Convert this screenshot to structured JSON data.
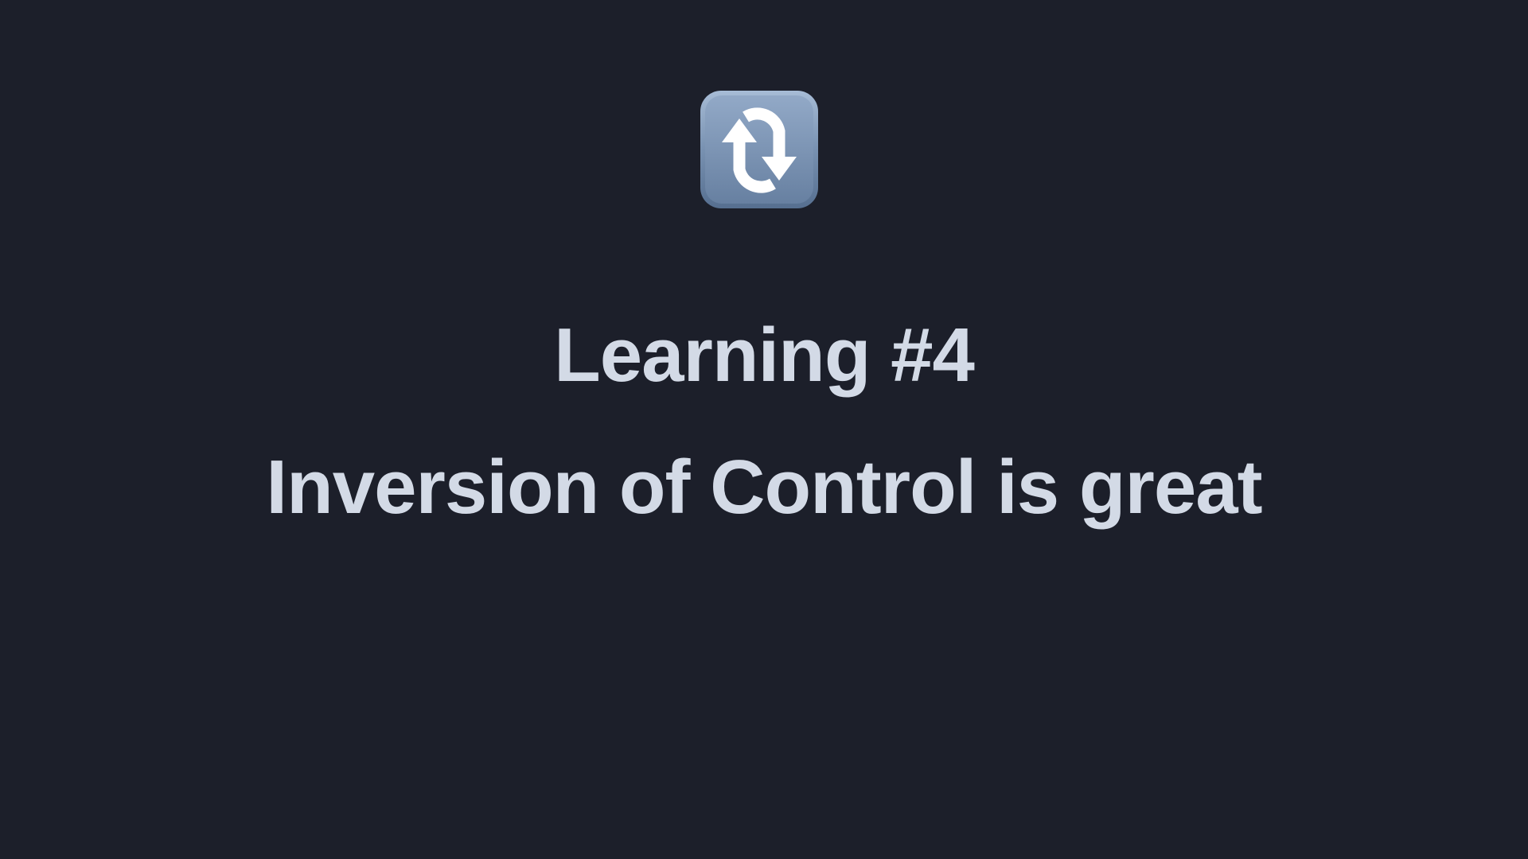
{
  "slide": {
    "icon": "clockwise-vertical-arrows-icon",
    "heading": "Learning #4",
    "subheading": "Inversion of Control is great"
  },
  "colors": {
    "background": "#1c1f2a",
    "text": "#d3dae6",
    "icon_tile_top": "#9eb4d0",
    "icon_tile_bottom": "#5c7494",
    "icon_glyph": "#ffffff"
  }
}
